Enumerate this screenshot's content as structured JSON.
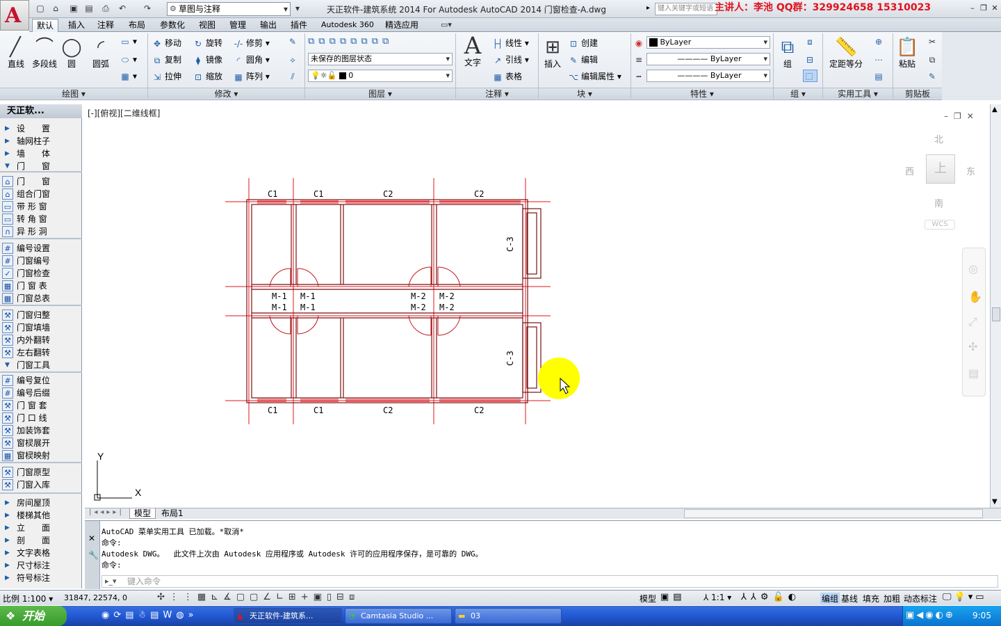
{
  "title_bar": {
    "workspace": "草图与注释",
    "doc_title": "天正软件-建筑系统 2014  For Autodesk AutoCAD 2014    门窗检查-A.dwg",
    "search_placeholder": "键入关键字或短语",
    "watermark": "主讲人：李池    QQ群：329924658 15310023"
  },
  "tabs": [
    "默认",
    "插入",
    "注释",
    "布局",
    "参数化",
    "视图",
    "管理",
    "输出",
    "插件",
    "Autodesk 360",
    "精选应用"
  ],
  "ribbon": {
    "draw": {
      "title": "绘图",
      "buttons": [
        "直线",
        "多段线",
        "圆",
        "圆弧"
      ]
    },
    "modify": {
      "title": "修改",
      "buttons": [
        "移动",
        "旋转",
        "修剪",
        "复制",
        "镜像",
        "圆角",
        "拉伸",
        "缩放",
        "阵列"
      ]
    },
    "layers": {
      "title": "图层",
      "state": "未保存的图层状态",
      "current": "0"
    },
    "annotation": {
      "title": "注释",
      "big": "文字",
      "buttons": [
        "线性",
        "引线",
        "表格"
      ]
    },
    "block": {
      "title": "块",
      "big": "插入",
      "buttons": [
        "创建",
        "编辑",
        "编辑属性"
      ]
    },
    "properties": {
      "title": "特性",
      "color": "ByLayer",
      "linetype": "ByLayer",
      "lineweight": "ByLayer"
    },
    "groups": {
      "title": "组",
      "big": "组"
    },
    "utilities": {
      "title": "实用工具",
      "big": "定距等分"
    },
    "clipboard": {
      "title": "剪贴板",
      "big": "粘贴"
    }
  },
  "sidebar": {
    "title": "天正软...",
    "items": [
      {
        "label": "设　　置",
        "icon": "tri"
      },
      {
        "label": "轴网柱子",
        "icon": "tri"
      },
      {
        "label": "墙　　体",
        "icon": "tri"
      },
      {
        "label": "门　　窗",
        "icon": "tri-open"
      },
      {
        "label": "门　　窗",
        "icon": "door"
      },
      {
        "label": "组合门窗",
        "icon": "door"
      },
      {
        "label": "带 形 窗",
        "icon": "win"
      },
      {
        "label": "转 角 窗",
        "icon": "win"
      },
      {
        "label": "异 形 洞",
        "icon": "arch"
      },
      {
        "label": "编号设置",
        "icon": "tag"
      },
      {
        "label": "门窗编号",
        "icon": "tag"
      },
      {
        "label": "门窗检查",
        "icon": "check"
      },
      {
        "label": "门 窗 表",
        "icon": "table"
      },
      {
        "label": "门窗总表",
        "icon": "table"
      },
      {
        "label": "门窗归整",
        "icon": "tool"
      },
      {
        "label": "门窗填墙",
        "icon": "tool"
      },
      {
        "label": "内外翻转",
        "icon": "tool"
      },
      {
        "label": "左右翻转",
        "icon": "tool"
      },
      {
        "label": "门窗工具",
        "icon": "tri-open"
      },
      {
        "label": "编号复位",
        "icon": "tag"
      },
      {
        "label": "编号后缀",
        "icon": "tag"
      },
      {
        "label": "门 窗 套",
        "icon": "tool"
      },
      {
        "label": "门 口 线",
        "icon": "tool"
      },
      {
        "label": "加装饰套",
        "icon": "tool"
      },
      {
        "label": "窗棂展开",
        "icon": "tool"
      },
      {
        "label": "窗棂映射",
        "icon": "table"
      },
      {
        "label": "门窗原型",
        "icon": "tool"
      },
      {
        "label": "门窗入库",
        "icon": "tool"
      },
      {
        "label": "房间屋顶",
        "icon": "tri"
      },
      {
        "label": "楼梯其他",
        "icon": "tri"
      },
      {
        "label": "立　　面",
        "icon": "tri"
      },
      {
        "label": "剖　　面",
        "icon": "tri"
      },
      {
        "label": "文字表格",
        "icon": "tri"
      },
      {
        "label": "尺寸标注",
        "icon": "tri"
      },
      {
        "label": "符号标注",
        "icon": "tri"
      }
    ]
  },
  "viewport": {
    "label": "[-][俯视][二维线框]",
    "viewcube": {
      "north": "北",
      "south": "南",
      "east": "东",
      "west": "西",
      "top": "上",
      "wcs": "WCS"
    },
    "labels": {
      "c1": "C1",
      "c2": "C2",
      "c3": "C-3",
      "m1": "M-1",
      "m2": "M-2"
    },
    "ucs": {
      "x": "X",
      "y": "Y"
    }
  },
  "layout_tabs": [
    "模型",
    "布局1"
  ],
  "command": {
    "lines": [
      "AutoCAD 菜单实用工具 已加载。*取消*",
      "命令:",
      "Autodesk DWG。  此文件上次由 Autodesk 应用程序或 Autodesk 许可的应用程序保存，是可靠的 DWG。",
      "命令:"
    ],
    "placeholder": "键入命令"
  },
  "status": {
    "scale": "比例 1:100",
    "coords": "31847, 22574, 0",
    "model": "模型",
    "annoscale": "1:1",
    "right_buttons": [
      "编组",
      "基线",
      "填充",
      "加粗",
      "动态标注"
    ]
  },
  "taskbar": {
    "start": "开始",
    "tasks": [
      "天正软件-建筑系...",
      "Camtasia Studio ...",
      "03"
    ],
    "clock": "9:05"
  }
}
